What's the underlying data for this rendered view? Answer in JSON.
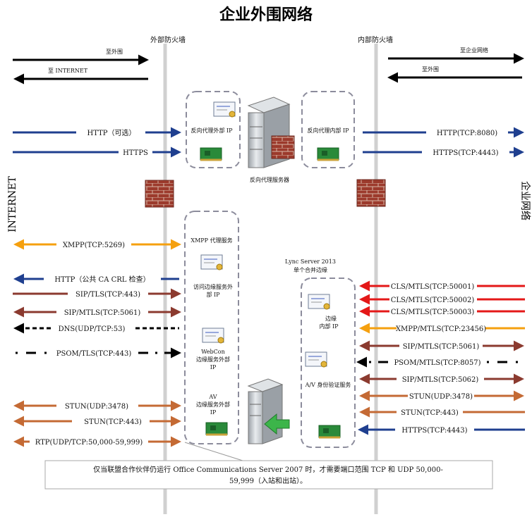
{
  "title": "企业外围网络",
  "firewalls": {
    "outer": "外部防火墙",
    "inner": "内部防火墙"
  },
  "side_labels": {
    "left": "INTERNET",
    "right": "企业网络"
  },
  "top_arrows": {
    "left_out": "至外围",
    "left_in": "至 INTERNET",
    "right_out": "至企业网络",
    "right_in": "至外围"
  },
  "reverse_proxy": {
    "external_ip": "反向代理外部 IP",
    "internal_ip": "反向代理内部 IP",
    "server_label": "反向代理服务器"
  },
  "edge": {
    "caption_line1": "Lync Server 2013",
    "caption_line2": "单个合并边缘",
    "xmpp_service": "XMPP 代理服务",
    "access_line1": "访问边缘服务外",
    "access_line2": "部 IP",
    "webconf_line1": "WebCon",
    "webconf_line2": "边缘服务外部",
    "webconf_line3": "IP",
    "av_line1": "AV",
    "av_line2": "边缘服务外部",
    "av_line3": "IP",
    "internal_line1": "边缘",
    "internal_line2": "内部 IP",
    "av_auth": "A/V 身份验证服务"
  },
  "left_protocols": [
    "HTTP（可选）",
    "HTTPS",
    "XMPP(TCP:5269)",
    "HTTP（公共 CA CRL 检查）",
    "SIP/TLS(TCP:443)",
    "SIP/MTLS(TCP:5061)",
    "DNS(UDP/TCP:53)",
    "PSOM/TLS(TCP:443)",
    "STUN(UDP:3478)",
    "STUN(TCP:443)",
    "RTP(UDP/TCP:50,000-59,999)"
  ],
  "right_protocols": [
    "HTTP(TCP:8080)",
    "HTTPS(TCP:4443)",
    "CLS/MTLS(TCP:50001)",
    "CLS/MTLS(TCP:50002)",
    "CLS/MTLS(TCP:50003)",
    "XMPP/MTLS(TCP:23456)",
    "SIP/MTLS(TCP:5061)",
    "PSOM/MTLS(TCP:8057)",
    "SIP/MTLS(TCP:5062)",
    "STUN(UDP:3478)",
    "STUN(TCP:443)",
    "HTTPS(TCP:4443)"
  ],
  "note": {
    "line1": "仅当联盟合作伙伴仍运行 Office Communications Server 2007 时，才需要端口范围 TCP 和 UDP 50,000-",
    "line2": "59,999（入站和出站）。"
  },
  "colors": {
    "blue": "#1f3f8f",
    "orange": "#f5a00f",
    "brown": "#8b3a2f",
    "copper": "#c46a34",
    "red": "#e41818",
    "black": "#000000",
    "firewall_line": "#d0d0d0",
    "dash_box": "#8c8c9c"
  }
}
